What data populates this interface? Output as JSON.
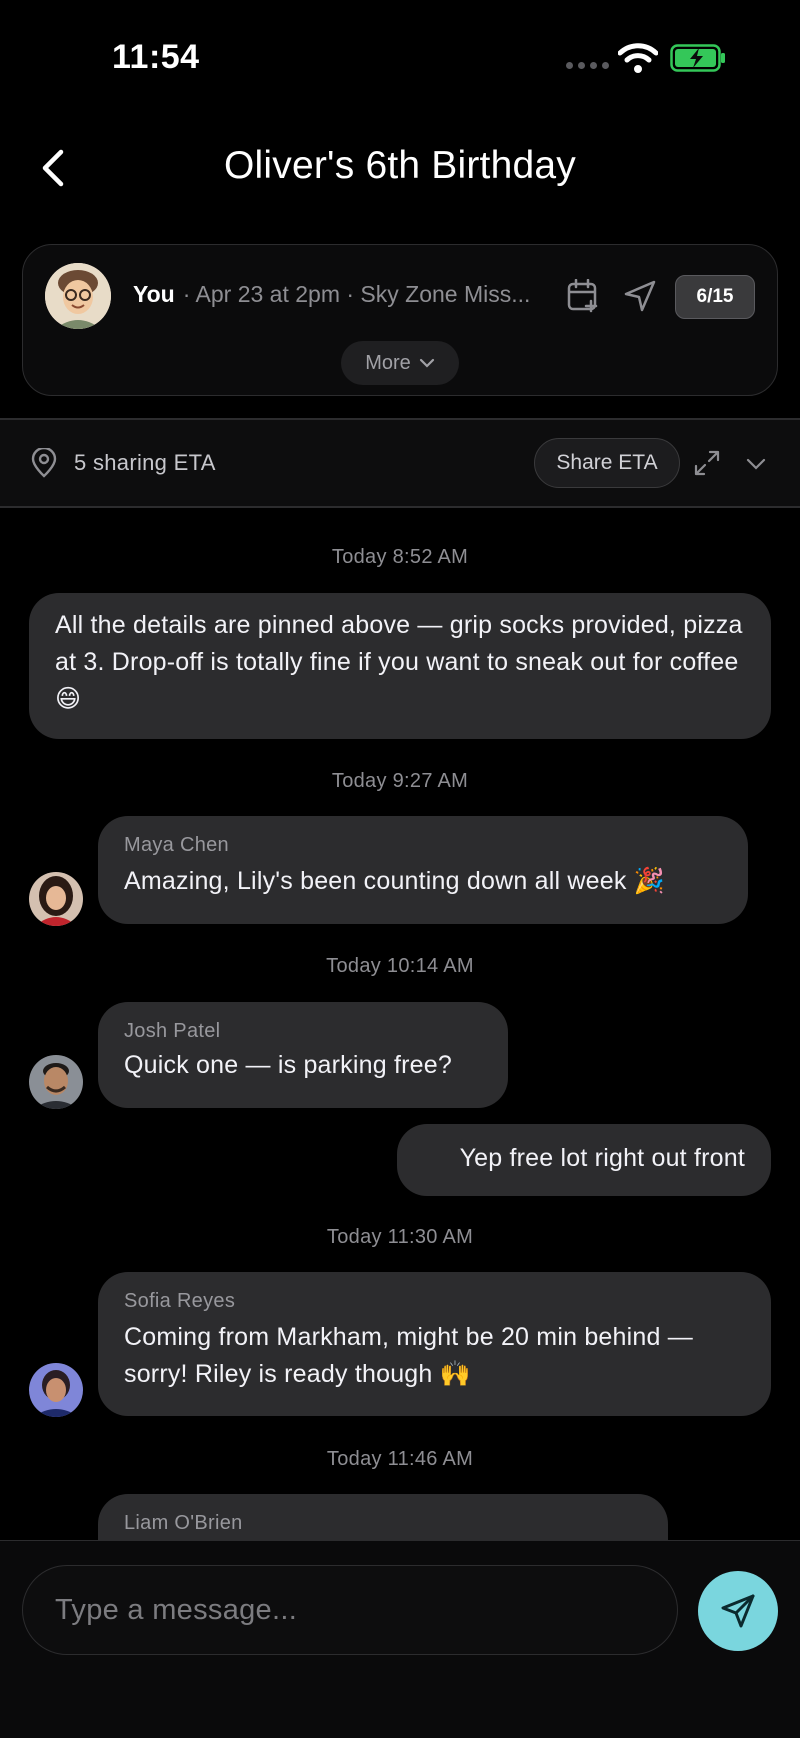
{
  "status_bar": {
    "time": "11:54"
  },
  "header": {
    "title": "Oliver's 6th Birthday"
  },
  "event": {
    "host": "You",
    "details": "· Apr 23 at 2pm · Sky Zone Miss...",
    "count": "6/15",
    "more_label": "More"
  },
  "eta": {
    "sharing_text": "5 sharing ETA",
    "share_button": "Share ETA"
  },
  "messages": [
    {
      "timestamp": "Today 8:52 AM",
      "sender": "",
      "text": "All the details are pinned above — grip socks provided, pizza at 3. Drop-off is totally fine if you want to sneak out for coffee 😄",
      "own": false
    },
    {
      "timestamp": "Today 9:27 AM",
      "sender": "Maya Chen",
      "text": "Amazing, Lily's been counting down all week 🎉"
    },
    {
      "timestamp": "Today 10:14 AM",
      "sender": "Josh Patel",
      "text": "Quick one — is parking free?"
    },
    {
      "timestamp": "",
      "sender": "",
      "text": "Yep free lot right out front",
      "own": true
    },
    {
      "timestamp": "Today 11:30 AM",
      "sender": "Sofia Reyes",
      "text": "Coming from Markham, might be 20 min behind — sorry! Riley is ready though 🙌"
    },
    {
      "timestamp": "Today 11:46 AM",
      "sender": "Liam O'Brien",
      "text": ""
    }
  ],
  "composer": {
    "placeholder": "Type a message..."
  },
  "colors": {
    "accent": "#7ad6de",
    "bubble": "#2c2c2e",
    "background": "#000000",
    "battery": "#34c759"
  }
}
